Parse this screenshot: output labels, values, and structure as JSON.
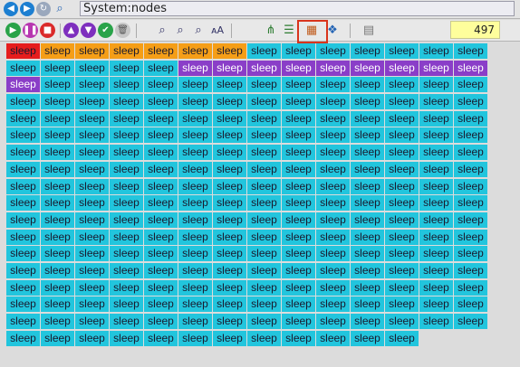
{
  "nav": {
    "path": "System:nodes"
  },
  "toolbar": {
    "count": "497"
  },
  "colors": {
    "sleep": "#22c5dd",
    "busy": "#f59e17",
    "down": "#e61d1d",
    "partition": "#8a3ec8",
    "highlight": "#d9341c"
  },
  "icons": {
    "back": "back-arrow-icon",
    "forward": "forward-arrow-icon",
    "refresh": "refresh-icon",
    "search": "search-icon",
    "play": "play-icon",
    "pause": "pause-icon",
    "stop": "stop-icon",
    "up": "arrow-up-icon",
    "down": "arrow-down-icon",
    "check": "check-icon",
    "trash": "trash-icon",
    "zoom_in": "zoom-in-icon",
    "zoom_out": "zoom-out-icon",
    "zoom_fit": "zoom-fit-icon",
    "font": "font-size-icon",
    "tree": "tree-view-icon",
    "list": "list-view-icon",
    "grid": "grid-view-icon",
    "palette": "palette-icon",
    "doc": "document-icon"
  },
  "nodes": [
    {
      "state": "down",
      "label": "sleep"
    },
    {
      "state": "busy",
      "label": "sleep"
    },
    {
      "state": "busy",
      "label": "sleep"
    },
    {
      "state": "busy",
      "label": "sleep"
    },
    {
      "state": "busy",
      "label": "sleep"
    },
    {
      "state": "busy",
      "label": "sleep"
    },
    {
      "state": "busy",
      "label": "sleep"
    },
    {
      "state": "sleep",
      "label": "sleep"
    },
    {
      "state": "sleep",
      "label": "sleep"
    },
    {
      "state": "sleep",
      "label": "sleep"
    },
    {
      "state": "sleep",
      "label": "sleep"
    },
    {
      "state": "sleep",
      "label": "sleep"
    },
    {
      "state": "sleep",
      "label": "sleep"
    },
    {
      "state": "sleep",
      "label": "sleep"
    },
    {
      "state": "sleep",
      "label": "sleep"
    },
    {
      "state": "sleep",
      "label": "sleep"
    },
    {
      "state": "sleep",
      "label": "sleep"
    },
    {
      "state": "sleep",
      "label": "sleep"
    },
    {
      "state": "sleep",
      "label": "sleep"
    },
    {
      "state": "part",
      "label": "sleep"
    },
    {
      "state": "part",
      "label": "sleep"
    },
    {
      "state": "part",
      "label": "sleep"
    },
    {
      "state": "part",
      "label": "sleep"
    },
    {
      "state": "part",
      "label": "sleep"
    },
    {
      "state": "part",
      "label": "sleep"
    },
    {
      "state": "part",
      "label": "sleep"
    },
    {
      "state": "part",
      "label": "sleep"
    },
    {
      "state": "part",
      "label": "sleep"
    },
    {
      "state": "part",
      "label": "sleep"
    },
    {
      "state": "sleep",
      "label": "sleep"
    }
  ],
  "fill_label": "sleep",
  "fill_rows": 15,
  "last_row_count": 10,
  "columns": 14
}
